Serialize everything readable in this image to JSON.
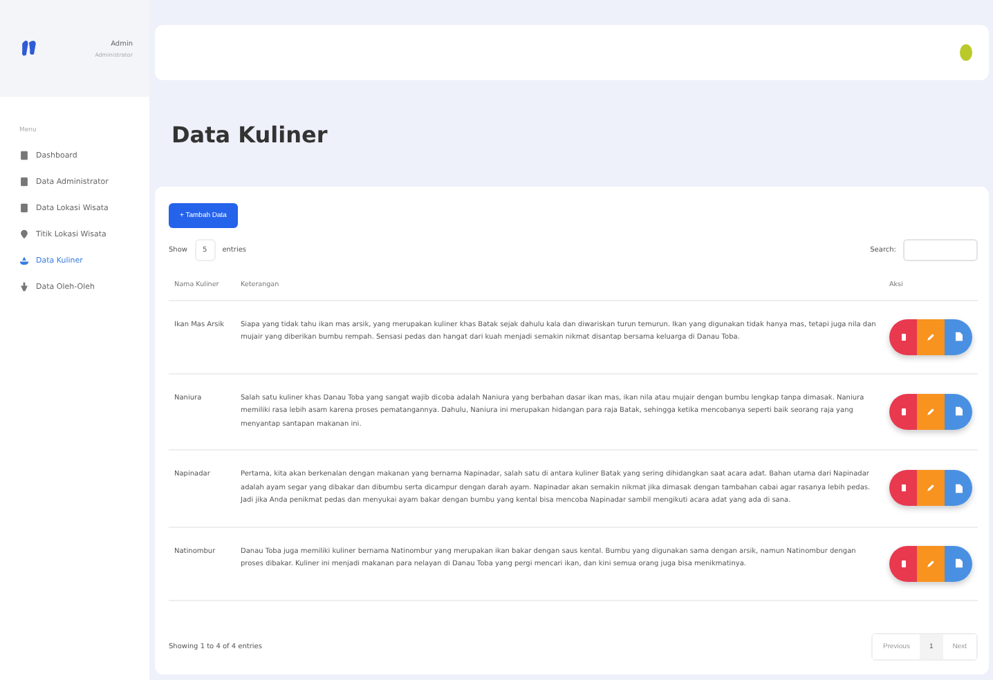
{
  "profile": {
    "name": "Admin",
    "role": "Administrator"
  },
  "sidebar": {
    "heading": "Menu",
    "items": [
      {
        "label": "Dashboard",
        "selected": false
      },
      {
        "label": "Data Administrator",
        "selected": false
      },
      {
        "label": "Data Lokasi Wisata",
        "selected": false
      },
      {
        "label": "Titik Lokasi Wisata",
        "selected": false
      },
      {
        "label": "Data Kuliner",
        "selected": true
      },
      {
        "label": "Data Oleh-Oleh",
        "selected": false
      }
    ]
  },
  "page_title": "Data Kuliner",
  "add_button": "+ Tambah Data",
  "length": {
    "before": "Show",
    "value": "5",
    "after": "entries"
  },
  "search": {
    "label": "Search:"
  },
  "table": {
    "columns": [
      "Nama Kuliner",
      "Keterangan",
      "Aksi"
    ],
    "rows": [
      {
        "name": "Ikan Mas Arsik",
        "description": "Siapa yang tidak tahu ikan mas arsik, yang merupakan kuliner khas Batak sejak dahulu kala dan diwariskan turun temurun. Ikan yang digunakan tidak hanya mas, tetapi juga nila dan mujair yang diberikan bumbu rempah. Sensasi pedas dan hangat dari kuah menjadi semakin nikmat disantap bersama keluarga di Danau Toba."
      },
      {
        "name": "Naniura",
        "description": "Salah satu kuliner khas Danau Toba yang sangat wajib dicoba adalah Naniura yang berbahan dasar ikan mas, ikan nila atau mujair dengan bumbu lengkap tanpa dimasak. Naniura memiliki rasa lebih asam karena proses pematangannya. Dahulu, Naniura ini merupakan hidangan para raja Batak, sehingga ketika mencobanya seperti baik seorang raja yang menyantap santapan makanan ini."
      },
      {
        "name": "Napinadar",
        "description": "Pertama, kita akan berkenalan dengan makanan yang bernama Napinadar, salah satu di antara kuliner Batak yang sering dihidangkan saat acara adat. Bahan utama dari Napinadar adalah ayam segar yang dibakar dan dibumbu serta dicampur dengan darah ayam. Napinadar akan semakin nikmat jika dimasak dengan tambahan cabai agar rasanya lebih pedas. Jadi jika Anda penikmat pedas dan menyukai ayam bakar dengan bumbu yang kental bisa mencoba Napinadar sambil mengikuti acara adat yang ada di sana."
      },
      {
        "name": "Natinombur",
        "description": "Danau Toba juga memiliki kuliner bernama Natinombur yang merupakan ikan bakar dengan saus kental. Bumbu yang digunakan sama dengan arsik, namun Natinombur dengan proses dibakar. Kuliner ini menjadi makanan para nelayan di Danau Toba yang pergi mencari ikan, dan kini semua orang juga bisa menikmatinya."
      }
    ]
  },
  "info": "Showing 1 to 4 of 4 entries",
  "pagination": [
    {
      "label": "Previous",
      "selected": false
    },
    {
      "label": "1",
      "selected": true
    },
    {
      "label": "Next",
      "selected": false
    }
  ]
}
